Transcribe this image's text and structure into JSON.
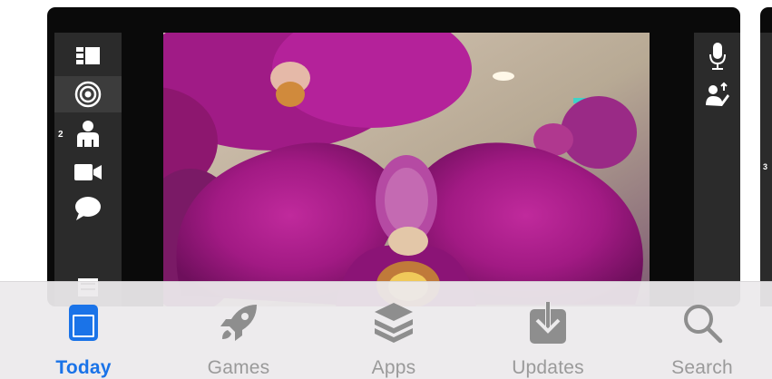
{
  "left_toolbar": {
    "items": [
      {
        "icon": "layout-icon"
      },
      {
        "icon": "target-icon",
        "selected": true
      },
      {
        "icon": "person-icon",
        "badge": "2"
      },
      {
        "icon": "video-camera-icon"
      },
      {
        "icon": "speech-bubble-icon"
      },
      {
        "icon": "document-icon"
      }
    ]
  },
  "right_toolbar": {
    "items": [
      {
        "icon": "microphone-icon"
      },
      {
        "icon": "gesture-hand-icon"
      }
    ]
  },
  "next_card": {
    "badge": "3"
  },
  "tabbar": {
    "active_color": "#1a73e8",
    "inactive_color": "#9a9a9a",
    "tabs": [
      {
        "label": "Today",
        "icon": "today-icon",
        "active": true
      },
      {
        "label": "Games",
        "icon": "rocket-icon"
      },
      {
        "label": "Apps",
        "icon": "layers-icon"
      },
      {
        "label": "Updates",
        "icon": "download-tray-icon"
      },
      {
        "label": "Search",
        "icon": "magnifier-icon"
      }
    ]
  }
}
